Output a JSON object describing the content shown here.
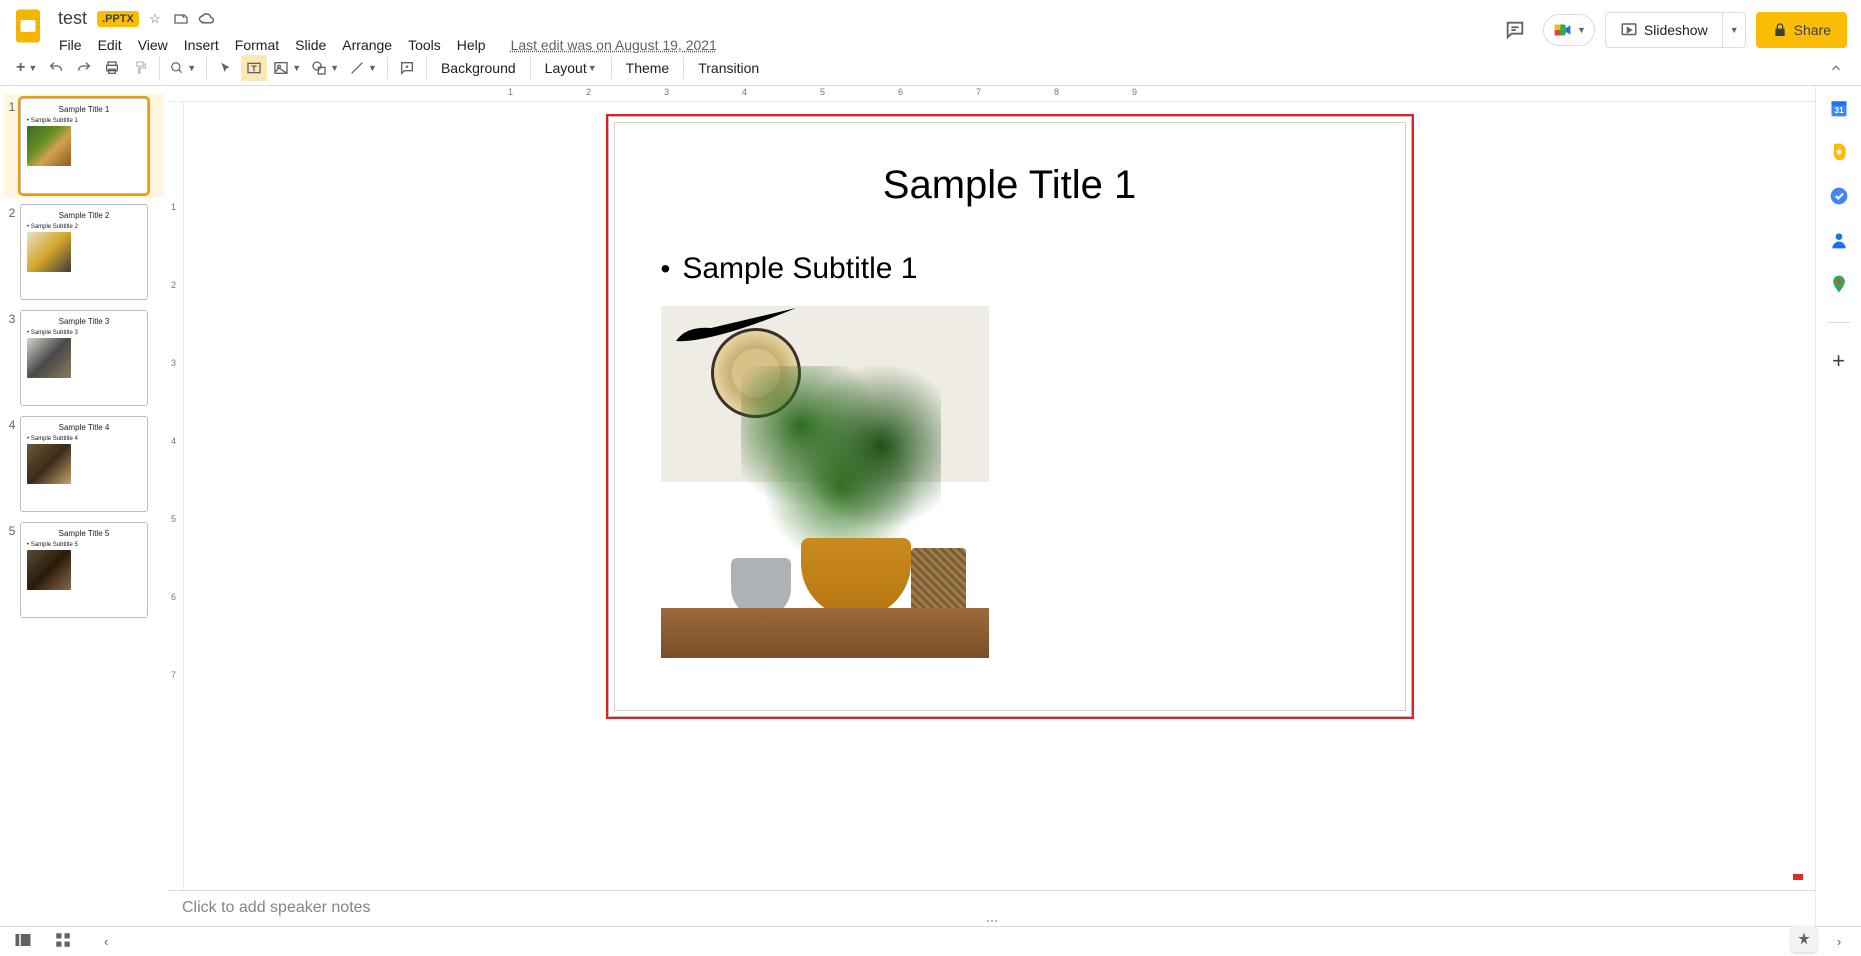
{
  "doc": {
    "title": "test",
    "badge": ".PPTX",
    "last_edit": "Last edit was on August 19, 2021"
  },
  "menu": {
    "file": "File",
    "edit": "Edit",
    "view": "View",
    "insert": "Insert",
    "format": "Format",
    "slide": "Slide",
    "arrange": "Arrange",
    "tools": "Tools",
    "help": "Help"
  },
  "header": {
    "slideshow": "Slideshow",
    "share": "Share"
  },
  "toolbar": {
    "background": "Background",
    "layout": "Layout",
    "theme": "Theme",
    "transition": "Transition"
  },
  "thumbs": [
    {
      "n": "1",
      "title": "Sample Title 1",
      "sub": "• Sample Subtitle 1"
    },
    {
      "n": "2",
      "title": "Sample Title 2",
      "sub": "• Sample Subtitle 2"
    },
    {
      "n": "3",
      "title": "Sample Title 3",
      "sub": "• Sample Subtitle 3"
    },
    {
      "n": "4",
      "title": "Sample Title 4",
      "sub": "• Sample Subtitle 4"
    },
    {
      "n": "5",
      "title": "Sample Title 5",
      "sub": "• Sample Subtitle 5"
    }
  ],
  "slide": {
    "title": "Sample Title 1",
    "bullet": "Sample Subtitle 1"
  },
  "notes": {
    "placeholder": "Click to add speaker notes"
  },
  "ruler_h": [
    "1",
    "2",
    "3",
    "4",
    "5",
    "6",
    "7",
    "8",
    "9"
  ],
  "ruler_v": [
    "1",
    "2",
    "3",
    "4",
    "5",
    "6",
    "7"
  ]
}
